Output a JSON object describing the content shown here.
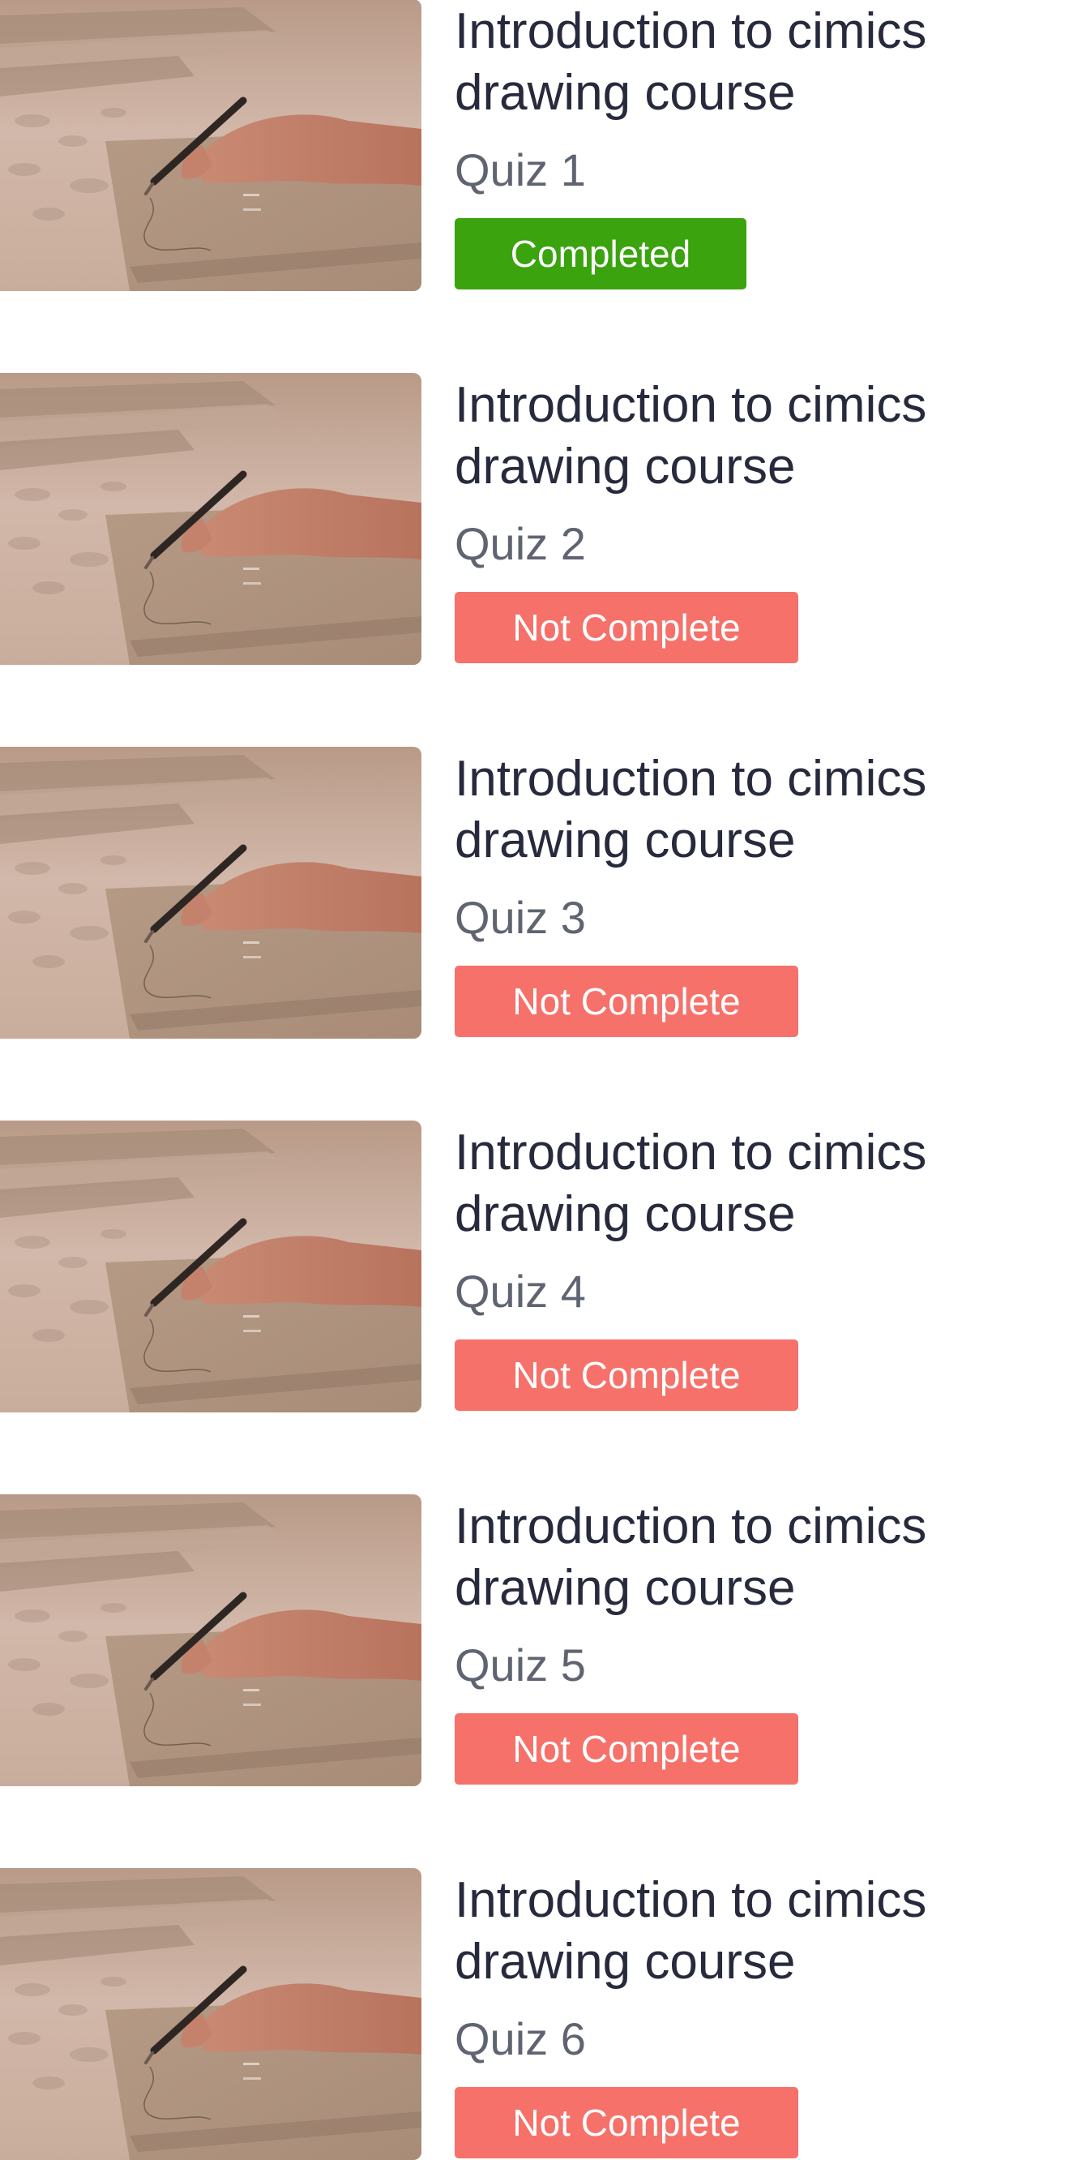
{
  "colors": {
    "completed": "#3aa30e",
    "not_complete": "#f6716a",
    "title_text": "#262a3c",
    "quiz_text": "#5f6471"
  },
  "quizzes": [
    {
      "course_title": "Introduction to cimics drawing course",
      "quiz_label": "Quiz 1",
      "status": "Completed",
      "status_kind": "completed",
      "thumbnail": "hand-drawing-photo"
    },
    {
      "course_title": "Introduction to cimics drawing course",
      "quiz_label": "Quiz 2",
      "status": "Not Complete",
      "status_kind": "incomplete",
      "thumbnail": "hand-drawing-photo"
    },
    {
      "course_title": "Introduction to cimics drawing course",
      "quiz_label": "Quiz 3",
      "status": "Not Complete",
      "status_kind": "incomplete",
      "thumbnail": "hand-drawing-photo"
    },
    {
      "course_title": "Introduction to cimics drawing course",
      "quiz_label": "Quiz 4",
      "status": "Not Complete",
      "status_kind": "incomplete",
      "thumbnail": "hand-drawing-photo"
    },
    {
      "course_title": "Introduction to cimics drawing course",
      "quiz_label": "Quiz 5",
      "status": "Not Complete",
      "status_kind": "incomplete",
      "thumbnail": "hand-drawing-photo"
    },
    {
      "course_title": "Introduction to cimics drawing course",
      "quiz_label": "Quiz 6",
      "status": "Not Complete",
      "status_kind": "incomplete",
      "thumbnail": "hand-drawing-photo"
    }
  ]
}
